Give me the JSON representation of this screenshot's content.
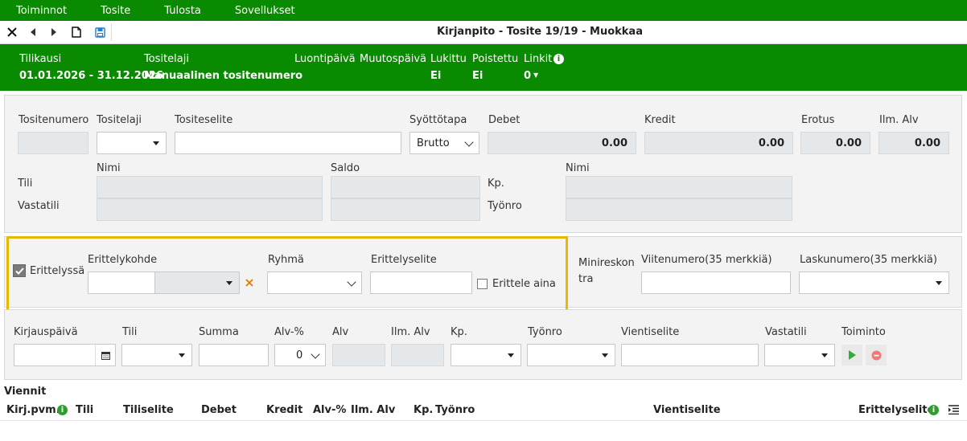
{
  "menu": [
    "Toiminnot",
    "Tosite",
    "Tulosta",
    "Sovellukset"
  ],
  "window_title": "Kirjanpito - Tosite 19/19 - Muokkaa",
  "info": {
    "tilikausi_label": "Tilikausi",
    "tilikausi_value": "01.01.2026 - 31.12.2026",
    "tositelaji_label": "Tositelaji",
    "tositelaji_value": "Manuaalinen tositenumero",
    "luontipaiva_label": "Luontipäivä",
    "muutospaiva_label": "Muutospäivä",
    "lukittu_label": "Lukittu",
    "lukittu_value": "Ei",
    "poistettu_label": "Poistettu",
    "poistettu_value": "Ei",
    "linkit_label": "Linkit",
    "linkit_value": "0"
  },
  "header_form": {
    "tositenumero": "Tositenumero",
    "tositelaji": "Tositelaji",
    "tositeselite": "Tositeselite",
    "syottotapa": "Syöttötapa",
    "syottotapa_value": "Brutto",
    "debet": "Debet",
    "debet_value": "0.00",
    "kredit": "Kredit",
    "kredit_value": "0.00",
    "erotus": "Erotus",
    "erotus_value": "0.00",
    "ilm_alv": "Ilm. Alv",
    "ilm_alv_value": "0.00",
    "nimi": "Nimi",
    "saldo": "Saldo",
    "tili": "Tili",
    "vastatili": "Vastatili",
    "kp": "Kp.",
    "nimi2": "Nimi",
    "tyonro": "Työnro"
  },
  "erittely": {
    "erittelyssa": "Erittelyssä",
    "erittelykohde": "Erittelykohde",
    "ryhma": "Ryhmä",
    "erittelyselite": "Erittelyselite",
    "erittele_aina": "Erittele aina",
    "minireskontra_1": "Minireskon",
    "minireskontra_2": "tra",
    "viitenumero": "Viitenumero(35 merkkiä)",
    "laskunumero": "Laskunumero(35 merkkiä)"
  },
  "entry_form": {
    "kirjauspaiva": "Kirjauspäivä",
    "tili": "Tili",
    "summa": "Summa",
    "alv_pct": "Alv-%",
    "alv_pct_value": "0",
    "alv": "Alv",
    "ilm_alv": "Ilm. Alv",
    "kp": "Kp.",
    "tyonro": "Työnro",
    "vientiselite": "Vientiselite",
    "vastatili": "Vastatili",
    "toiminto": "Toiminto"
  },
  "viennit": {
    "title": "Viennit",
    "columns": [
      "Kirj.pvm.",
      "Tili",
      "Tiliselite",
      "Debet",
      "Kredit",
      "Alv-%",
      "Ilm. Alv",
      "Kp.",
      "Työnro",
      "Vientiselite",
      "Erittelyselite"
    ]
  },
  "colors": {
    "brand_green": "#0a8a00",
    "highlight": "#e6b800",
    "info_green": "#2e9e2e"
  }
}
